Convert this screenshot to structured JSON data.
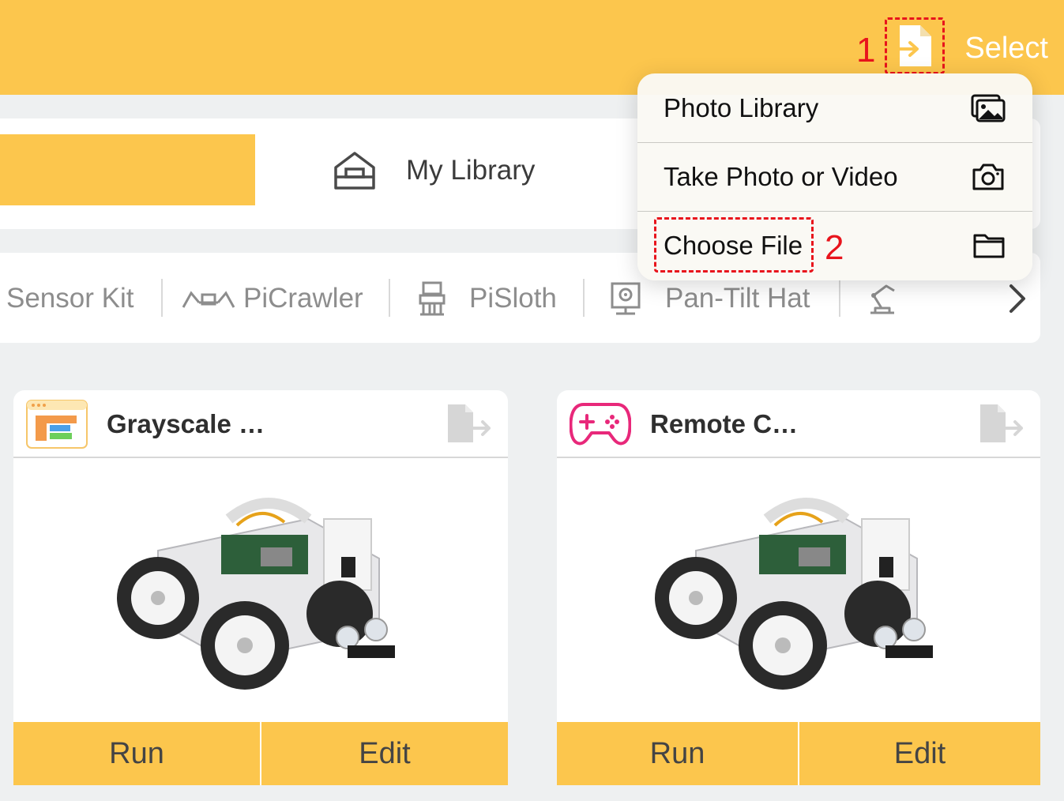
{
  "header": {
    "select_label": "Select",
    "annotation_1": "1",
    "annotation_2": "2"
  },
  "tabs": {
    "library_label": "My Library"
  },
  "kits": [
    {
      "label": "Sensor Kit",
      "icon": "sensor-kit-icon"
    },
    {
      "label": "PiCrawler",
      "icon": "picrawler-icon"
    },
    {
      "label": "PiSloth",
      "icon": "pisloth-icon"
    },
    {
      "label": "Pan-Tilt Hat",
      "icon": "pan-tilt-hat-icon"
    },
    {
      "label": "",
      "icon": "robot-arm-icon"
    }
  ],
  "menu": {
    "items": [
      {
        "label": "Photo Library",
        "icon": "photo-library-icon"
      },
      {
        "label": "Take Photo or Video",
        "icon": "camera-icon"
      },
      {
        "label": "Choose File",
        "icon": "folder-icon"
      }
    ]
  },
  "cards": [
    {
      "title": "Grayscale …",
      "run_label": "Run",
      "edit_label": "Edit",
      "image": "robot-car-photo"
    },
    {
      "title": "Remote C…",
      "run_label": "Run",
      "edit_label": "Edit",
      "image": "robot-car-photo"
    }
  ],
  "colors": {
    "accent": "#fcc64d",
    "annotation": "#e8141c",
    "gamepad": "#e8287a"
  }
}
